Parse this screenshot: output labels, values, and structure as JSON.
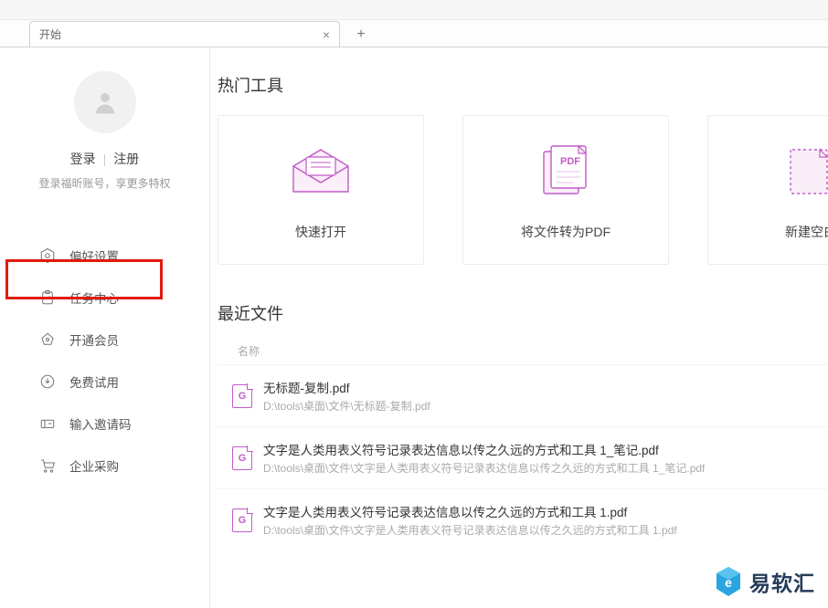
{
  "tab": {
    "active_label": "开始"
  },
  "sidebar": {
    "auth": {
      "login": "登录",
      "register": "注册",
      "subtitle": "登录福昕账号，享更多特权"
    },
    "items": [
      {
        "label": "偏好设置",
        "icon": "settings"
      },
      {
        "label": "任务中心",
        "icon": "clipboard"
      },
      {
        "label": "开通会员",
        "icon": "crown"
      },
      {
        "label": "免费试用",
        "icon": "download"
      },
      {
        "label": "输入邀请码",
        "icon": "ticket"
      },
      {
        "label": "企业采购",
        "icon": "cart"
      }
    ]
  },
  "content": {
    "hot_tools_title": "热门工具",
    "cards": [
      {
        "label": "快速打开",
        "icon": "envelope"
      },
      {
        "label": "将文件转为PDF",
        "icon": "pdf"
      },
      {
        "label": "新建空白",
        "icon": "blank"
      }
    ],
    "recent_title": "最近文件",
    "recent_header": "名称",
    "files": [
      {
        "name": "无标题-复制.pdf",
        "path": "D:\\tools\\桌面\\文件\\无标题-复制.pdf"
      },
      {
        "name": "文字是人类用表义符号记录表达信息以传之久远的方式和工具 1_笔记.pdf",
        "path": "D:\\tools\\桌面\\文件\\文字是人类用表义符号记录表达信息以传之久远的方式和工具 1_笔记.pdf"
      },
      {
        "name": "文字是人类用表义符号记录表达信息以传之久远的方式和工具 1.pdf",
        "path": "D:\\tools\\桌面\\文件\\文字是人类用表义符号记录表达信息以传之久远的方式和工具 1.pdf"
      }
    ]
  },
  "icon_letter": "G",
  "watermark": {
    "brand": "易软汇"
  }
}
